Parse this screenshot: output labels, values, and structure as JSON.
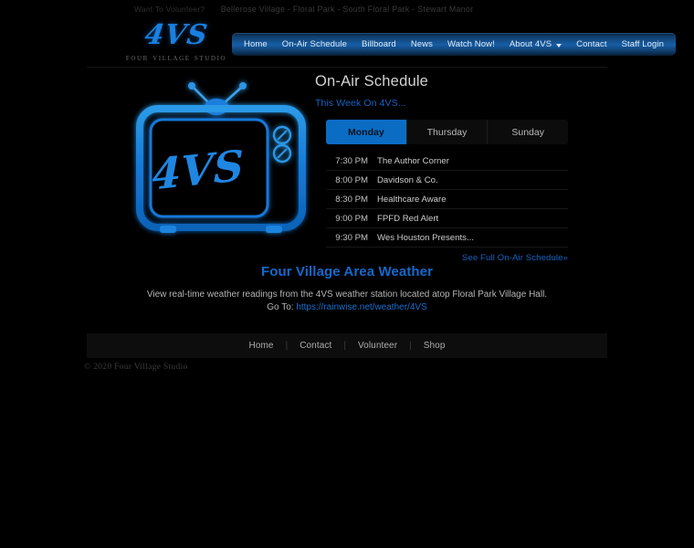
{
  "colors": {
    "page_bg": "#000000",
    "accent_blue": "#1569cc",
    "tab_active_bg": "#0b6cc4",
    "nav_gradient_mid": "#175ea6",
    "logo_blue": "#1a7fe0",
    "muted_text": "#b5b5b5"
  },
  "topbar": {
    "volunteer_text": "Want To Volunteer?",
    "villages_text": "Bellerose Village - Floral Park - South Floral Park - Stewart Manor"
  },
  "header": {
    "logo_mark": "4VS",
    "logo_subtitle": "Four Village Studio",
    "nav": [
      {
        "label": "Home",
        "has_caret": false
      },
      {
        "label": "On-Air Schedule",
        "has_caret": false
      },
      {
        "label": "Billboard",
        "has_caret": false
      },
      {
        "label": "News",
        "has_caret": false
      },
      {
        "label": "Watch Now!",
        "has_caret": false
      },
      {
        "label": "About 4VS",
        "has_caret": true
      },
      {
        "label": "Contact",
        "has_caret": false
      },
      {
        "label": "Staff Login",
        "has_caret": false
      }
    ]
  },
  "hero": {
    "tv_screen_text": "4VS",
    "tv_icon_name": "retro-television-illustration"
  },
  "schedule": {
    "title": "On-Air Schedule",
    "subtitle": "This Week On 4VS...",
    "tabs": [
      {
        "label": "Monday",
        "active": true
      },
      {
        "label": "Thursday",
        "active": false
      },
      {
        "label": "Sunday",
        "active": false
      }
    ],
    "rows": [
      {
        "time": "7:30 PM",
        "show": "The Author Corner"
      },
      {
        "time": "8:00 PM",
        "show": "Davidson & Co."
      },
      {
        "time": "8:30 PM",
        "show": "Healthcare Aware"
      },
      {
        "time": "9:00 PM",
        "show": "FPFD Red Alert"
      },
      {
        "time": "9:30 PM",
        "show": "Wes Houston Presents..."
      }
    ],
    "more_link": "See Full On-Air Schedule»"
  },
  "weather": {
    "title": "Four Village Area Weather",
    "description": "View real-time weather readings from the 4VS weather station located atop Floral Park Village Hall.",
    "goto_label": "Go To:",
    "url": "https://rainwise.net/weather/4VS"
  },
  "footer": {
    "links": [
      "Home",
      "Contact",
      "Volunteer",
      "Shop"
    ],
    "separator": "|",
    "copyright": "© 2020 Four Village Studio"
  }
}
